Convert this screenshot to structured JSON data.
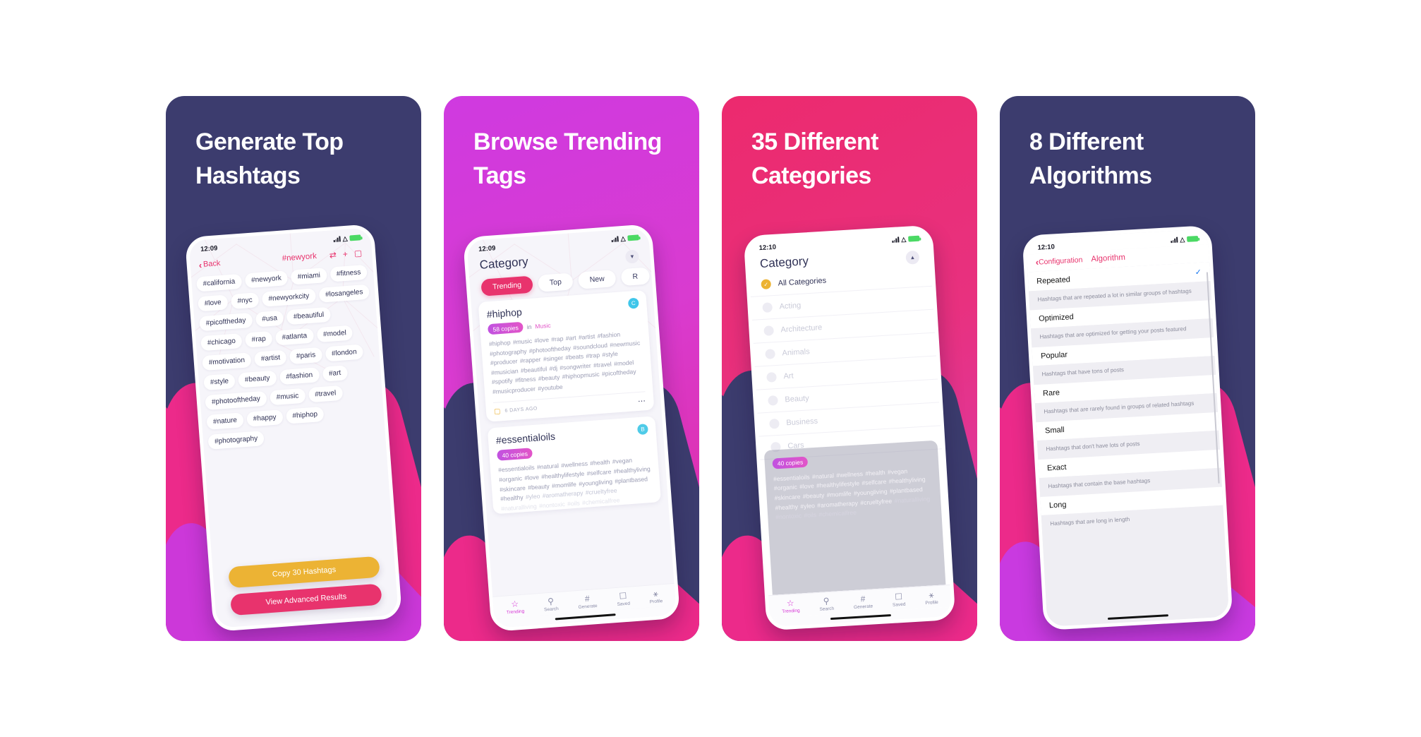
{
  "panels": [
    {
      "headline": "Generate Top\nHashtags",
      "bg_top": "#3c3c6e",
      "bg_cloud": "#ec2a8a",
      "bg_bottom": "#ec2a8a",
      "screen": "results",
      "status": {
        "time": "12:09",
        "location_icon": "location-arrow"
      },
      "nav": {
        "back_label": "Back",
        "title": "#newyork",
        "icons": [
          "shuffle-icon",
          "plus-icon",
          "bookmark-icon"
        ]
      },
      "tags": [
        "#california",
        "#newyork",
        "#miami",
        "#fitness",
        "#love",
        "#nyc",
        "#newyorkcity",
        "#losangeles",
        "#picoftheday",
        "#usa",
        "#beautiful",
        "#chicago",
        "#rap",
        "#atlanta",
        "#model",
        "#motivation",
        "#artist",
        "#paris",
        "#london",
        "#style",
        "#beauty",
        "#fashion",
        "#art",
        "#photooftheday",
        "#music",
        "#travel",
        "#nature",
        "#happy",
        "#hiphop",
        "#photography"
      ],
      "buttons": {
        "copy": "Copy 30 Hashtags",
        "advanced": "View Advanced Results",
        "copy_color": "#ecb334",
        "advanced_color": "#e8336d"
      }
    },
    {
      "headline": "Browse Trending\nTags",
      "bg_top": "#cf3ae0",
      "bg_cloud": "#3c3c6e",
      "bg_bottom": "#3c3c6e",
      "screen": "trending",
      "status": {
        "time": "12:09",
        "location_icon": "location-arrow"
      },
      "title": "Category",
      "collapse_icon": "chevron-down-icon",
      "chips": [
        "Trending",
        "Top",
        "New",
        "R"
      ],
      "active_chip": "Trending",
      "cards": [
        {
          "tag": "#hiphop",
          "avatar": "C",
          "copies": "58 copies",
          "in": "in",
          "category": "Music",
          "body": "#hiphop #music #love #rap #art #artist #fashion #photography #photooftheday #soundcloud #newmusic #producer #rapper #singer #beats #trap #style #musician #beautiful #dj #songwriter #travel #model #spotify #fitness #beauty #hiphopmusic #picoftheday #musicproducer #youtube",
          "bookmark_icon": "bookmark-icon",
          "ago": "6 DAYS AGO",
          "more_icon": "more-icon"
        },
        {
          "tag": "#essentialoils",
          "avatar": "B",
          "copies": "40 copies",
          "body": "#essentialoils #natural #wellness #health #vegan #organic #love #healthylifestyle #selfcare #healthyliving #skincare #beauty #momlife #youngliving #plantbased #healthy",
          "body_fade": "#yleo #aromatherapy #crueltyfree",
          "body_fade2": "#naturalliving #nontoxic #oils #chemicalfree"
        }
      ],
      "tabs": [
        {
          "label": "Trending",
          "icon": "star-icon",
          "active": true
        },
        {
          "label": "Search",
          "icon": "search-icon",
          "active": false
        },
        {
          "label": "Generate",
          "icon": "hash-icon",
          "active": false
        },
        {
          "label": "Saved",
          "icon": "bookmark-icon",
          "active": false
        },
        {
          "label": "Profile",
          "icon": "person-icon",
          "active": false
        }
      ]
    },
    {
      "headline": "35 Different\nCategories",
      "bg_top": "#ec2a6e",
      "bg_cloud": "#3c3c6e",
      "bg_bottom": "#3c3c6e",
      "screen": "categories",
      "status": {
        "time": "12:10",
        "location_icon": "location-arrow"
      },
      "title": "Category",
      "collapse_icon": "chevron-up-icon",
      "categories": [
        {
          "label": "All Categories",
          "selected": true
        },
        {
          "label": "Acting",
          "selected": false
        },
        {
          "label": "Architecture",
          "selected": false
        },
        {
          "label": "Animals",
          "selected": false
        },
        {
          "label": "Art",
          "selected": false
        },
        {
          "label": "Beauty",
          "selected": false
        },
        {
          "label": "Business",
          "selected": false
        },
        {
          "label": "Cars",
          "selected": false
        }
      ],
      "overlay_card": {
        "copies": "40 copies",
        "body": "#essentialoils #natural #wellness #health #vegan #organic #love #healthylifestyle #selfcare #healthyliving #skincare #beauty #momlife #youngliving #plantbased #healthy #yleo #aromatherapy #crueltyfree",
        "body_fade": "#naturalliving #nontoxic #oils #chemicalfree"
      },
      "tabs": [
        {
          "label": "Trending",
          "icon": "star-icon",
          "active": true
        },
        {
          "label": "Search",
          "icon": "search-icon",
          "active": false
        },
        {
          "label": "Generate",
          "icon": "hash-icon",
          "active": false
        },
        {
          "label": "Saved",
          "icon": "bookmark-icon",
          "active": false
        },
        {
          "label": "Profile",
          "icon": "person-icon",
          "active": false
        }
      ]
    },
    {
      "headline": "8 Different\nAlgorithms",
      "bg_top": "#3c3c6e",
      "bg_cloud": "#ec2a8a",
      "bg_bottom": "#c93ae0",
      "screen": "algorithms",
      "status": {
        "time": "12:10",
        "location_icon": "location-arrow"
      },
      "nav": {
        "back_label": "Configuration",
        "title": "Algorithm"
      },
      "algorithms": [
        {
          "name": "Repeated",
          "desc": "Hashtags that are repeated a lot in similar groups of hashtags",
          "checked": true
        },
        {
          "name": "Optimized",
          "desc": "Hashtags that are optimized for getting your posts featured",
          "checked": false
        },
        {
          "name": "Popular",
          "desc": "Hashtags that have tons of posts",
          "checked": false
        },
        {
          "name": "Rare",
          "desc": "Hashtags that are rarely found in groups of related hashtags",
          "checked": false
        },
        {
          "name": "Small",
          "desc": "Hashtags that don't have lots of posts",
          "checked": false
        },
        {
          "name": "Exact",
          "desc": "Hashtags that contain the base hashtags",
          "checked": false
        },
        {
          "name": "Long",
          "desc": "Hashtags that are long in length",
          "checked": false
        }
      ]
    }
  ]
}
